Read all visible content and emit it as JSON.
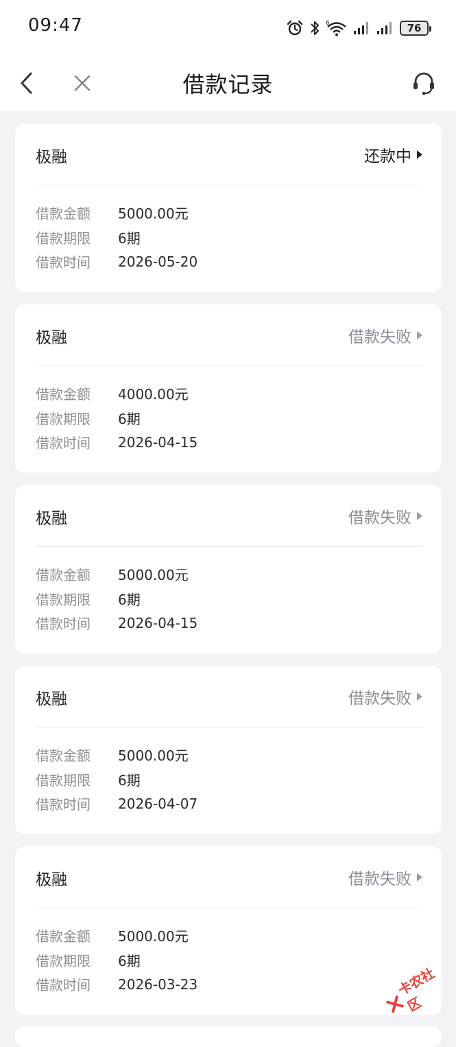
{
  "status_bar": {
    "time": "09:47",
    "battery": "76",
    "network_label": "6"
  },
  "nav": {
    "title": "借款记录"
  },
  "labels": {
    "amount": "借款金额",
    "term": "借款期限",
    "date": "借款时间"
  },
  "records": [
    {
      "lender": "极融",
      "status": "还款中",
      "status_type": "active",
      "amount": "5000.00元",
      "term": "6期",
      "date": "2026-05-20"
    },
    {
      "lender": "极融",
      "status": "借款失败",
      "status_type": "failed",
      "amount": "4000.00元",
      "term": "6期",
      "date": "2026-04-15"
    },
    {
      "lender": "极融",
      "status": "借款失败",
      "status_type": "failed",
      "amount": "5000.00元",
      "term": "6期",
      "date": "2026-04-15"
    },
    {
      "lender": "极融",
      "status": "借款失败",
      "status_type": "failed",
      "amount": "5000.00元",
      "term": "6期",
      "date": "2026-04-07"
    },
    {
      "lender": "极融",
      "status": "借款失败",
      "status_type": "failed",
      "amount": "5000.00元",
      "term": "6期",
      "date": "2026-03-23"
    }
  ],
  "watermark": {
    "text": "卡农社区"
  },
  "colors": {
    "active_status": "#1f1f1f",
    "failed_status": "#8a8d94",
    "watermark": "#e8413b"
  },
  "icons": [
    "alarm-icon",
    "bluetooth-icon",
    "wifi-icon",
    "signal-icon",
    "battery-icon",
    "back-icon",
    "close-icon",
    "customer-service-icon"
  ]
}
